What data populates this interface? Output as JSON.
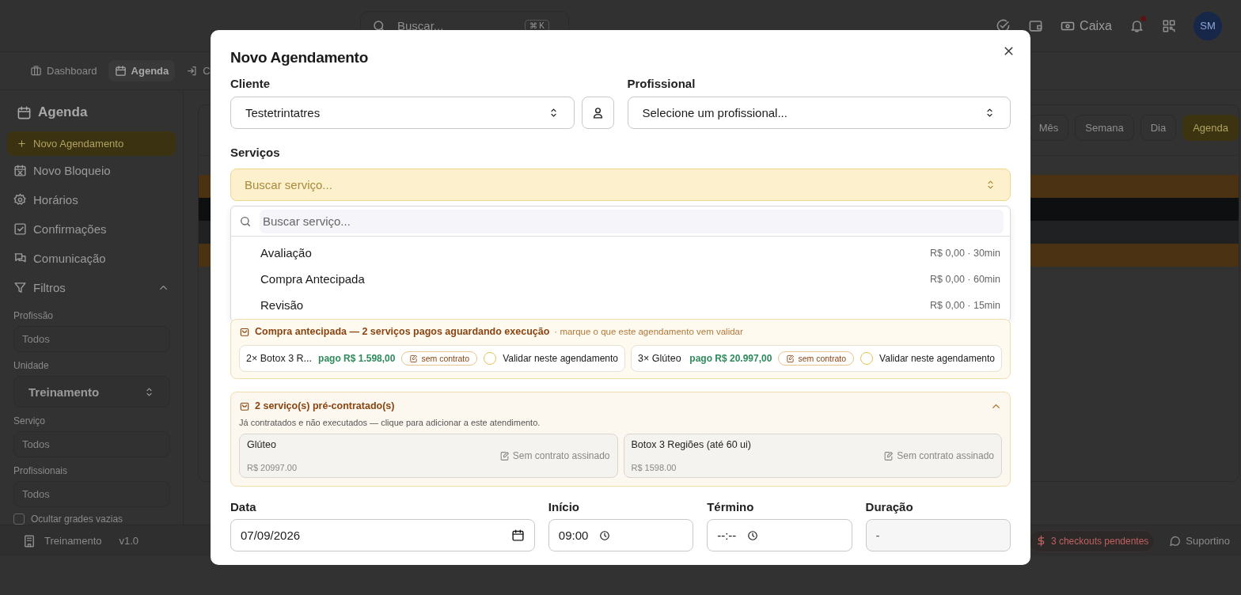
{
  "header": {
    "search_placeholder": "Buscar...",
    "shortcut": "⌘ K",
    "cash_label": "Caixa",
    "avatar": "SM"
  },
  "nav_tabs": [
    {
      "label": "Dashboard",
      "selected": false
    },
    {
      "label": "Agenda",
      "selected": true
    },
    {
      "label": "C",
      "selected": false
    }
  ],
  "sidebar": {
    "title": "Agenda",
    "primary_button": "Novo Agendamento",
    "items": [
      {
        "label": "Novo Bloqueio",
        "kind": "block"
      },
      {
        "label": "Horários",
        "kind": "hours"
      },
      {
        "label": "Confirmações",
        "kind": "confirm"
      },
      {
        "label": "Comunicação",
        "kind": "chat"
      }
    ],
    "filters_label": "Filtros",
    "filters_expanded": true,
    "filters": [
      {
        "label": "Profissão",
        "placeholder": "Todos",
        "kind": "input"
      },
      {
        "label": "Unidade",
        "value": "Treinamento",
        "kind": "select"
      },
      {
        "label": "Serviço",
        "placeholder": "Todos",
        "kind": "input"
      },
      {
        "label": "Profissionais",
        "placeholder": "Todos",
        "kind": "input"
      }
    ],
    "hide_empty": {
      "label": "Ocultar grades vazias",
      "checked": false
    }
  },
  "calendar": {
    "views": [
      {
        "label": "Mês",
        "selected": false
      },
      {
        "label": "Semana",
        "selected": false
      },
      {
        "label": "Dia",
        "selected": false
      },
      {
        "label": "Agenda",
        "selected": true
      }
    ],
    "events": [
      {
        "color": "#4a3212"
      },
      {
        "color": "#0e0f11"
      },
      {
        "color": "#1f2123"
      },
      {
        "color": "#4a3212"
      }
    ]
  },
  "footer": {
    "unit": "Treinamento",
    "version": "v1.0",
    "checkouts": "3 checkouts pendentes",
    "support": "Suportino"
  },
  "modal": {
    "title": "Novo Agendamento",
    "client": {
      "label": "Cliente",
      "value": "Testetrintatres"
    },
    "professional": {
      "label": "Profissional",
      "placeholder": "Selecione um profissional..."
    },
    "services": {
      "label": "Serviços",
      "placeholder": "Buscar serviço...",
      "search_placeholder": "Buscar serviço...",
      "options": [
        {
          "name": "Avaliação",
          "info": "R$ 0,00 · 30min"
        },
        {
          "name": "Compra Antecipada",
          "info": "R$ 0,00 · 60min"
        },
        {
          "name": "Revisão",
          "info": "R$ 0,00 · 15min"
        }
      ]
    },
    "prepaid": {
      "title": "Compra antecipada — 2 serviços pagos aguardando execução",
      "hint": "· marque o que este agendamento vem validar",
      "items": [
        {
          "name": "2× Botox 3 R...",
          "paid": "pago R$ 1.598,00",
          "contract": "sem contrato",
          "validate_label": "Validar neste agendamento",
          "checked": false
        },
        {
          "name": "3× Glúteo",
          "paid": "pago R$ 20.997,00",
          "contract": "sem contrato",
          "validate_label": "Validar neste agendamento",
          "checked": false
        }
      ]
    },
    "precontracted": {
      "title": "2 serviço(s) pré-contratado(s)",
      "expanded": true,
      "description": "Já contratados e não executados — clique para adicionar a este atendimento.",
      "items": [
        {
          "name": "Glúteo",
          "price": "R$ 20997.00",
          "contract": "Sem contrato assinado"
        },
        {
          "name": "Botox 3 Regiões (até 60 ui)",
          "price": "R$ 1598.00",
          "contract": "Sem contrato assinado"
        }
      ]
    },
    "schedule": {
      "date": {
        "label": "Data",
        "value": "07/09/2026"
      },
      "start": {
        "label": "Início",
        "value": "09:00"
      },
      "end": {
        "label": "Término",
        "value": "--:--"
      },
      "duration": {
        "label": "Duração",
        "value": "-"
      }
    }
  }
}
